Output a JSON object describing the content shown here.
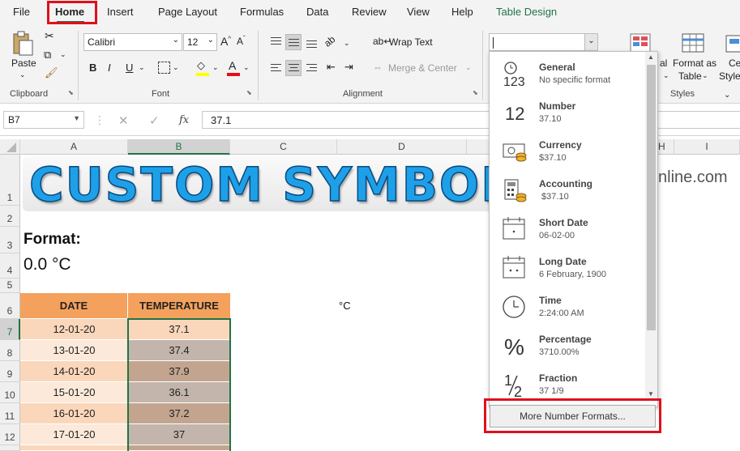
{
  "menu": {
    "tabs": [
      "File",
      "Home",
      "Insert",
      "Page Layout",
      "Formulas",
      "Data",
      "Review",
      "View",
      "Help",
      "Table Design"
    ]
  },
  "ribbon": {
    "clipboard": {
      "paste": "Paste",
      "group": "Clipboard"
    },
    "font": {
      "name": "Calibri",
      "size": "12",
      "group": "Font"
    },
    "alignment": {
      "wrap_text": "Wrap Text",
      "merge_center": "Merge & Center",
      "group": "Alignment"
    },
    "styles": {
      "format_as": "Format as",
      "table": "Table",
      "group": "Styles",
      "partial_cond": "al",
      "partial_cell": "Ce",
      "partial_style": "Style"
    }
  },
  "formula_bar": {
    "name_box": "B7",
    "fx": "fx",
    "value": "37.1"
  },
  "columns": [
    "A",
    "B",
    "C",
    "D",
    "H",
    "I"
  ],
  "rows": [
    "1",
    "2",
    "3",
    "4",
    "5",
    "6",
    "7",
    "8",
    "9",
    "10",
    "11",
    "12"
  ],
  "sheet": {
    "banner": "CUSTOM SYMBOL",
    "watermark": "nline.com",
    "format_label": "Format:",
    "format_value": "0.0 °C",
    "degree_c": "°C",
    "table_headers": [
      "DATE",
      "TEMPERATURE"
    ],
    "table_rows": [
      [
        "12-01-20",
        "37.1"
      ],
      [
        "13-01-20",
        "37.4"
      ],
      [
        "14-01-20",
        "37.9"
      ],
      [
        "15-01-20",
        "36.1"
      ],
      [
        "16-01-20",
        "37.2"
      ],
      [
        "17-01-20",
        "37"
      ]
    ]
  },
  "number_format_menu": [
    {
      "name": "General",
      "example": "No specific format",
      "icon": "general-123-icon"
    },
    {
      "name": "Number",
      "example": "37.10",
      "icon": "number-12-icon"
    },
    {
      "name": "Currency",
      "example": "$37.10",
      "icon": "currency-icon"
    },
    {
      "name": "Accounting",
      "example": " $37.10",
      "icon": "accounting-icon"
    },
    {
      "name": "Short Date",
      "example": "06-02-00",
      "icon": "short-date-icon"
    },
    {
      "name": "Long Date",
      "example": "6 February, 1900",
      "icon": "long-date-icon"
    },
    {
      "name": "Time",
      "example": "2:24:00 AM",
      "icon": "clock-icon"
    },
    {
      "name": "Percentage",
      "example": "3710.00%",
      "icon": "percent-icon"
    },
    {
      "name": "Fraction",
      "example": "37 1/9",
      "icon": "fraction-icon"
    }
  ],
  "more_formats": "More Number Formats...",
  "colors": {
    "accent": "#217346",
    "highlight": "#e0101a",
    "banner": "#1ea0e8",
    "header_fill": "#f4a15d"
  }
}
